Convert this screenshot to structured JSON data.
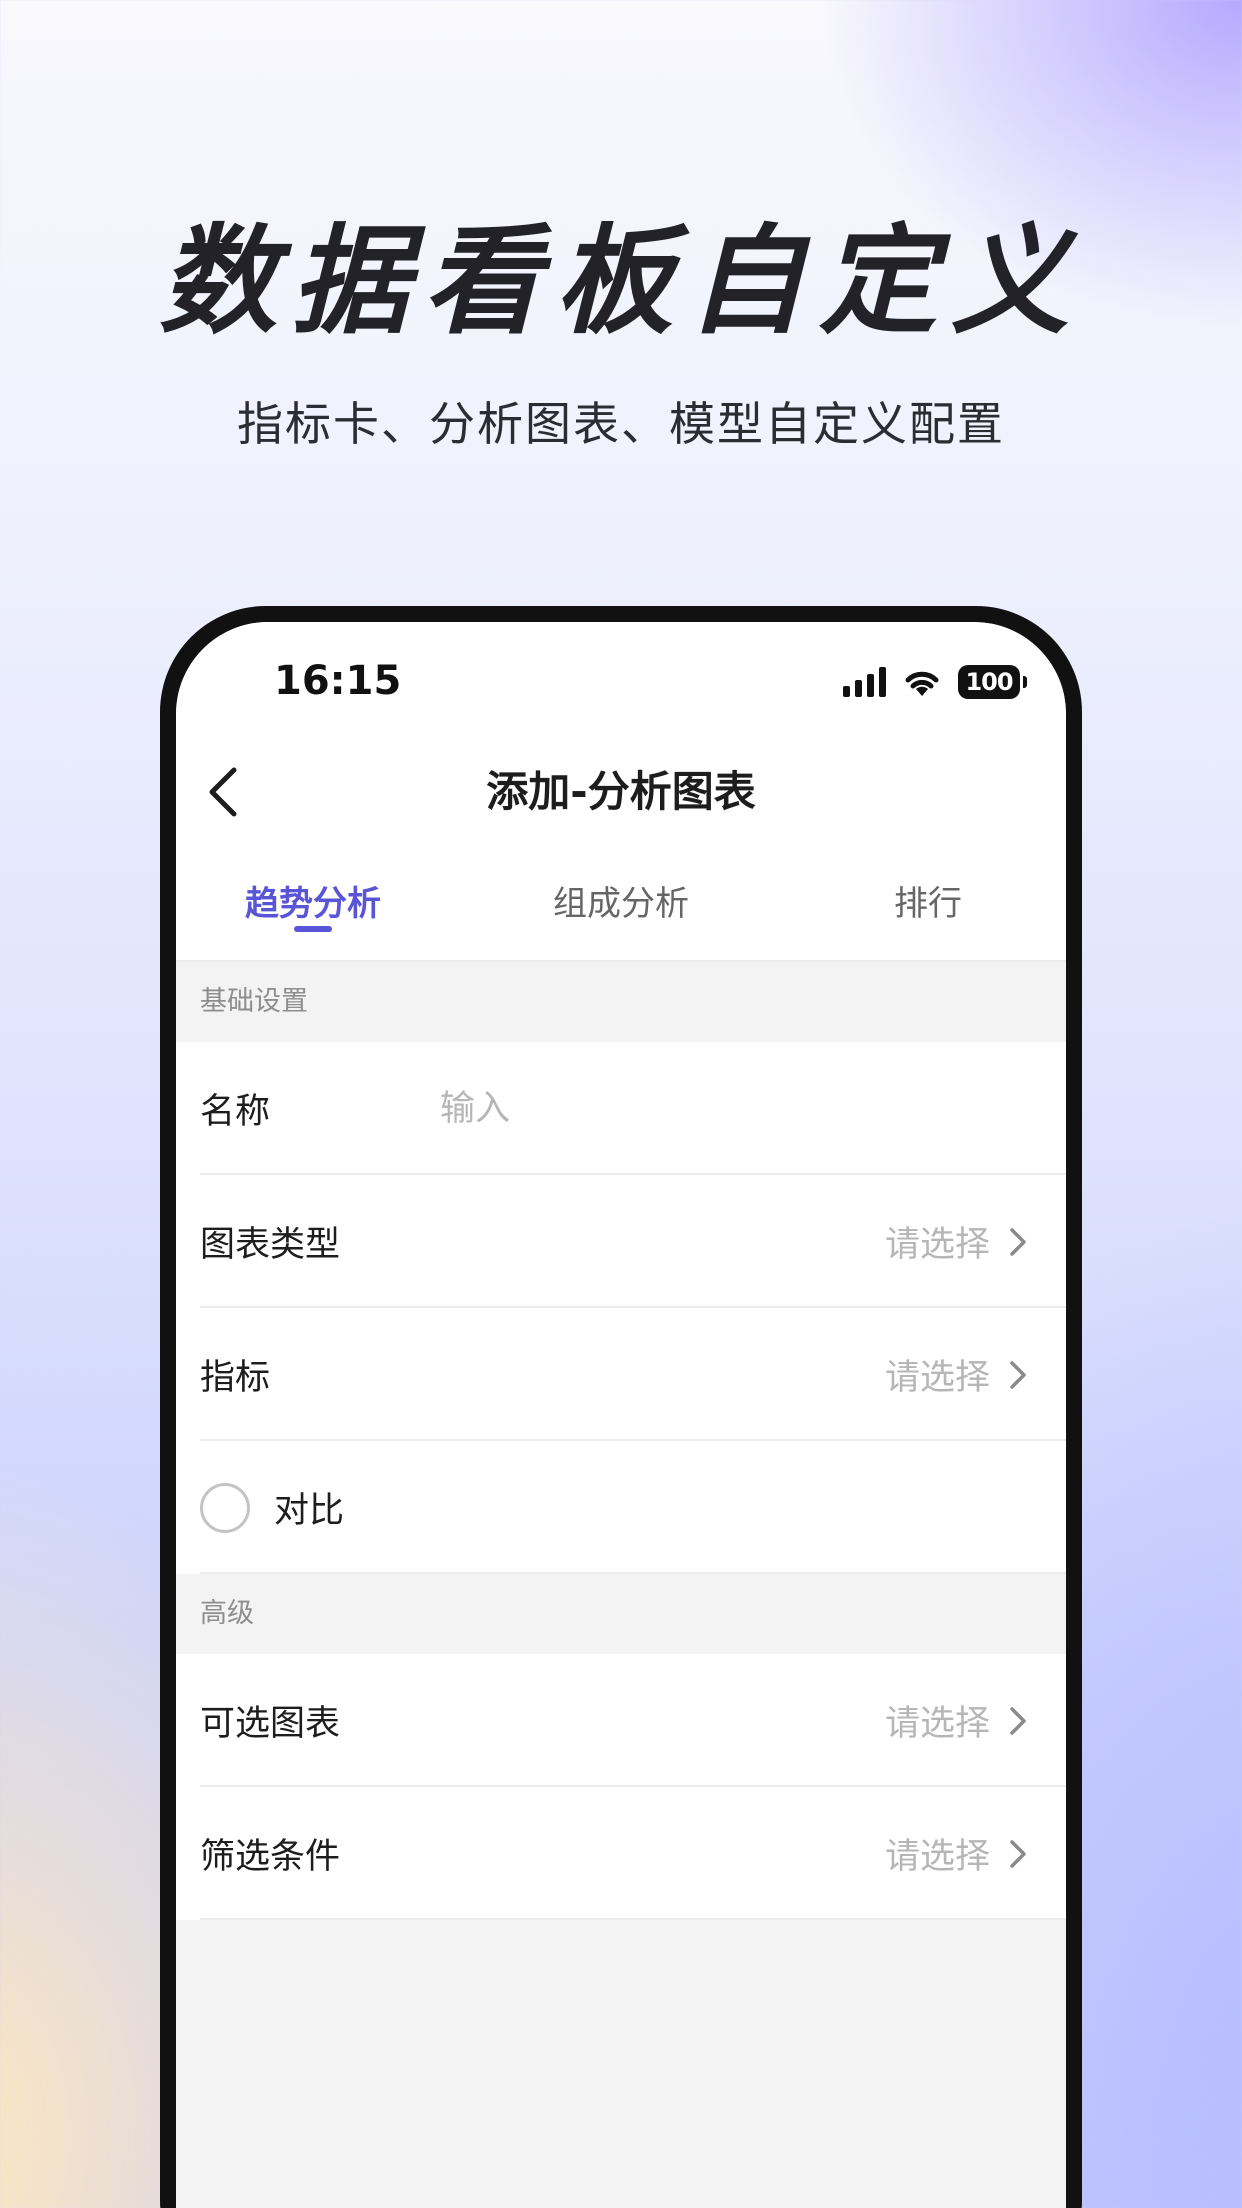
{
  "hero": {
    "title": "数据看板自定义",
    "subtitle": "指标卡、分析图表、模型自定义配置"
  },
  "status_bar": {
    "time": "16:15",
    "battery": "100",
    "icons": [
      "signal-icon",
      "wifi-icon",
      "battery-icon"
    ]
  },
  "nav": {
    "back_icon": "chevron-left-icon",
    "title": "添加-分析图表"
  },
  "tabs": [
    {
      "label": "趋势分析",
      "active": true
    },
    {
      "label": "组成分析",
      "active": false
    },
    {
      "label": "排行",
      "active": false
    }
  ],
  "sections": {
    "basic": {
      "header": "基础设置",
      "name_row": {
        "label": "名称",
        "placeholder": "输入",
        "value": ""
      },
      "chart_type_row": {
        "label": "图表类型",
        "value": "请选择"
      },
      "metric_row": {
        "label": "指标",
        "value": "请选择"
      },
      "compare_row": {
        "label": "对比",
        "checked": false
      }
    },
    "advanced": {
      "header": "高级",
      "optional_chart_row": {
        "label": "可选图表",
        "value": "请选择"
      },
      "filter_row": {
        "label": "筛选条件",
        "value": "请选择"
      }
    }
  },
  "colors": {
    "accent": "#5a55d7",
    "placeholder": "#b6b6b6",
    "section_bg": "#f3f3f3"
  }
}
